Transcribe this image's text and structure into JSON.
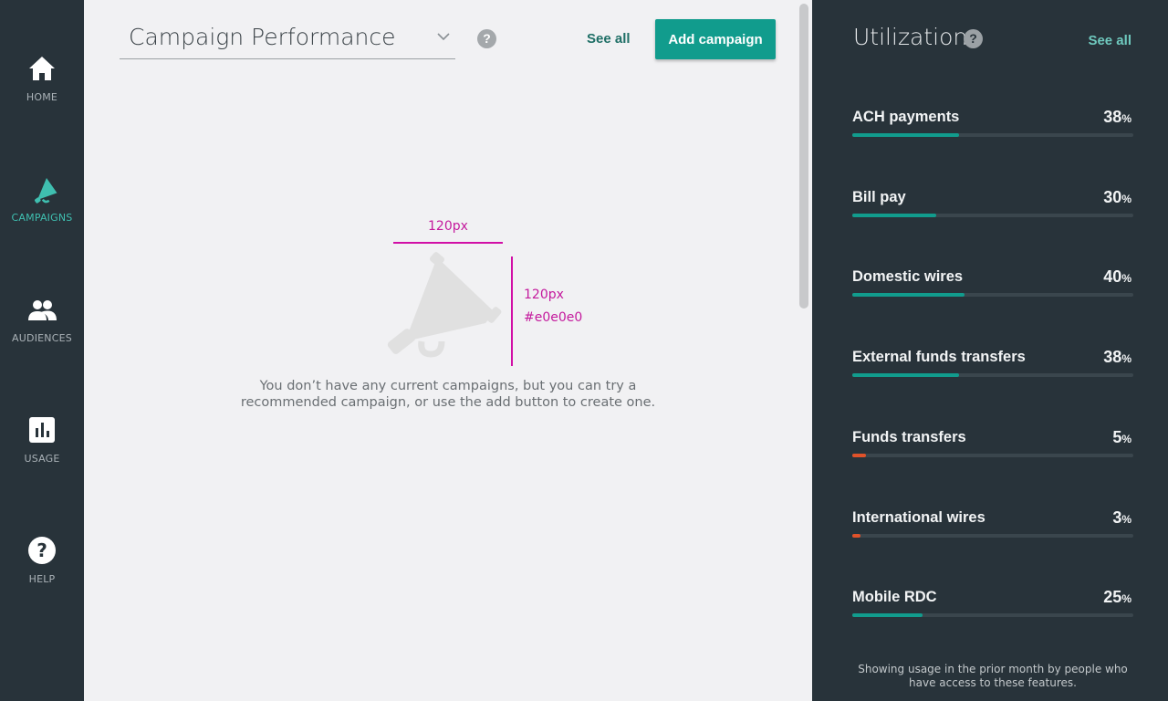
{
  "nav": {
    "items": [
      {
        "label": "HOME",
        "icon": "home-icon",
        "active": false
      },
      {
        "label": "CAMPAIGNS",
        "icon": "megaphone-icon",
        "active": true
      },
      {
        "label": "AUDIENCES",
        "icon": "people-icon",
        "active": false
      },
      {
        "label": "USAGE",
        "icon": "bar-chart-icon",
        "active": false
      },
      {
        "label": "HELP",
        "icon": "help-icon",
        "active": false
      }
    ]
  },
  "main": {
    "dropdown_value": "Campaign Performance",
    "help_symbol": "?",
    "see_all": "See all",
    "add_button": "Add campaign",
    "spec_width_label": "120px",
    "spec_height_label": "120px",
    "spec_color_label": "#e0e0e0",
    "empty_message": "You don’t have any current campaigns, but you can try a recommended campaign, or use the add button to create one."
  },
  "panel": {
    "title": "Utilization",
    "help_symbol": "?",
    "see_all": "See all",
    "metrics": [
      {
        "name": "ACH payments",
        "value": "38",
        "unit": "%",
        "fraction": 0.38,
        "color": "#119c8d"
      },
      {
        "name": "Bill pay",
        "value": "30",
        "unit": "%",
        "fraction": 0.3,
        "color": "#119c8d"
      },
      {
        "name": "Domestic wires",
        "value": "40",
        "unit": "%",
        "fraction": 0.4,
        "color": "#119c8d"
      },
      {
        "name": "External funds transfers",
        "value": "38",
        "unit": "%",
        "fraction": 0.38,
        "color": "#119c8d"
      },
      {
        "name": "Funds transfers",
        "value": "5",
        "unit": "%",
        "fraction": 0.05,
        "color": "#e0522a"
      },
      {
        "name": "International wires",
        "value": "3",
        "unit": "%",
        "fraction": 0.03,
        "color": "#e0522a"
      },
      {
        "name": "Mobile RDC",
        "value": "25",
        "unit": "%",
        "fraction": 0.25,
        "color": "#119c8d"
      }
    ],
    "note": "Showing usage in the prior month by people who have access to these features."
  },
  "colors": {
    "accent": "#119c8d",
    "active_nav": "#3fbfb0",
    "warning": "#e0522a",
    "spec": "#d10fa6"
  }
}
